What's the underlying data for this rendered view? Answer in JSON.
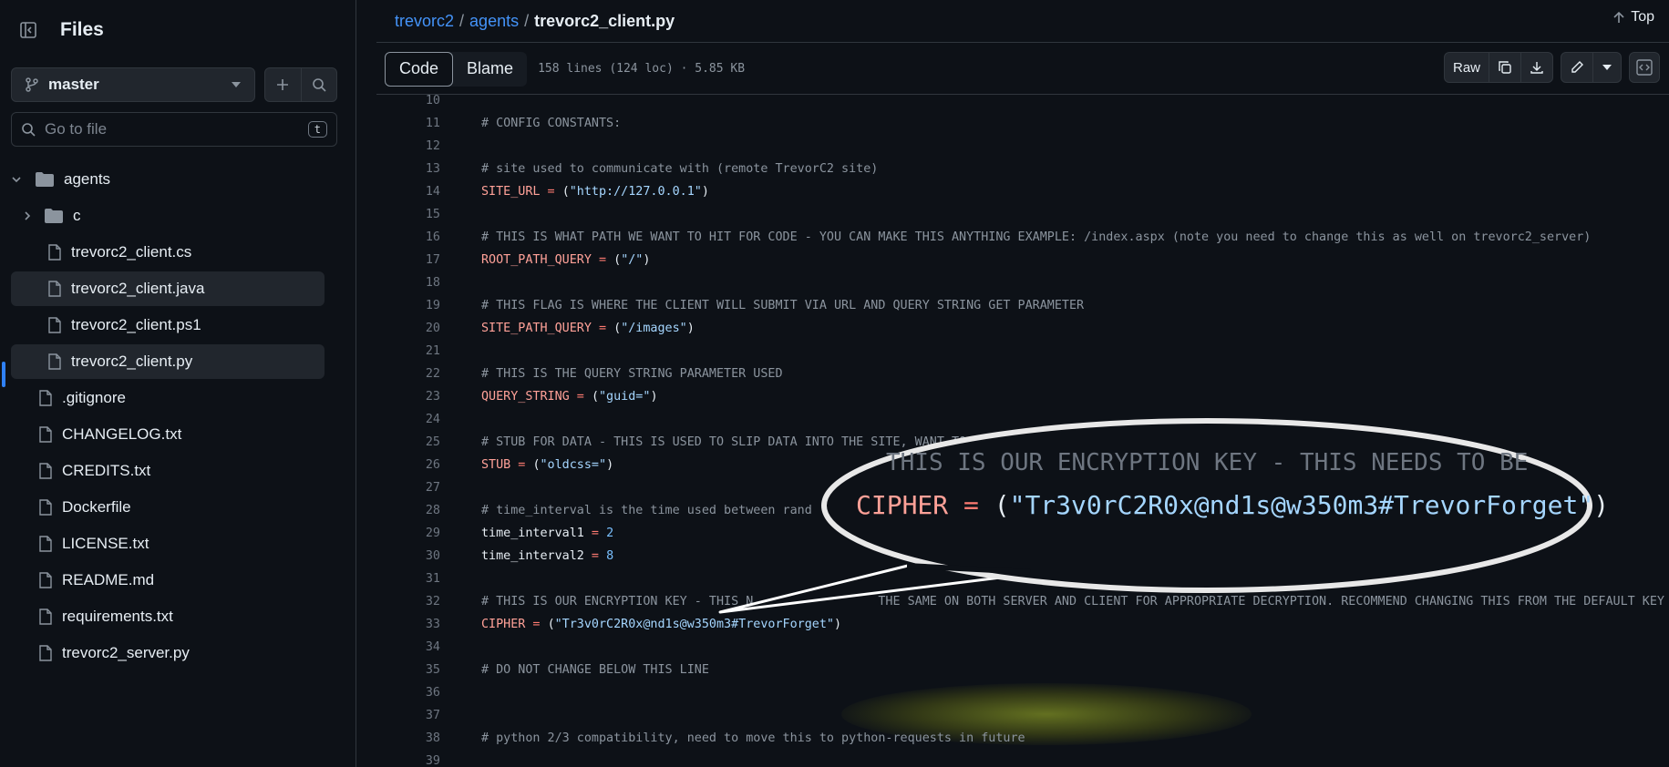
{
  "sidebar": {
    "title": "Files",
    "branch": "master",
    "goto_placeholder": "Go to file",
    "goto_shortcut": "t",
    "tree": [
      {
        "label": "agents",
        "type": "folder-open"
      },
      {
        "label": "c",
        "type": "folder"
      },
      {
        "label": "trevorc2_client.cs",
        "type": "file"
      },
      {
        "label": "trevorc2_client.java",
        "type": "file"
      },
      {
        "label": "trevorc2_client.ps1",
        "type": "file"
      },
      {
        "label": "trevorc2_client.py",
        "type": "file"
      },
      {
        "label": ".gitignore",
        "type": "file"
      },
      {
        "label": "CHANGELOG.txt",
        "type": "file"
      },
      {
        "label": "CREDITS.txt",
        "type": "file"
      },
      {
        "label": "Dockerfile",
        "type": "file"
      },
      {
        "label": "LICENSE.txt",
        "type": "file"
      },
      {
        "label": "README.md",
        "type": "file"
      },
      {
        "label": "requirements.txt",
        "type": "file"
      },
      {
        "label": "trevorc2_server.py",
        "type": "file"
      }
    ]
  },
  "breadcrumb": {
    "repo": "trevorc2",
    "folder": "agents",
    "file": "trevorc2_client.py",
    "sep": "/"
  },
  "top_link": "Top",
  "filebar": {
    "tab_code": "Code",
    "tab_blame": "Blame",
    "meta": "158 lines (124 loc) · 5.85 KB",
    "raw_label": "Raw"
  },
  "code_lines": [
    {
      "n": "10",
      "segs": []
    },
    {
      "n": "11",
      "segs": [
        [
          "cm",
          "# CONFIG CONSTANTS:"
        ]
      ]
    },
    {
      "n": "12",
      "segs": []
    },
    {
      "n": "13",
      "segs": [
        [
          "cm",
          "# site used to communicate with (remote TrevorC2 site)"
        ]
      ]
    },
    {
      "n": "14",
      "segs": [
        [
          "var",
          "SITE_URL"
        ],
        [
          "op",
          " = "
        ],
        [
          "",
          "("
        ],
        [
          "str",
          "\"http://127.0.0.1\""
        ],
        [
          "",
          ")"
        ]
      ]
    },
    {
      "n": "15",
      "segs": []
    },
    {
      "n": "16",
      "segs": [
        [
          "cm",
          "# THIS IS WHAT PATH WE WANT TO HIT FOR CODE - YOU CAN MAKE THIS ANYTHING EXAMPLE: /index.aspx (note you need to change this as well on trevorc2_server)"
        ]
      ]
    },
    {
      "n": "17",
      "segs": [
        [
          "var",
          "ROOT_PATH_QUERY"
        ],
        [
          "op",
          " = "
        ],
        [
          "",
          "("
        ],
        [
          "str",
          "\"/\""
        ],
        [
          "",
          ")"
        ]
      ]
    },
    {
      "n": "18",
      "segs": []
    },
    {
      "n": "19",
      "segs": [
        [
          "cm",
          "# THIS FLAG IS WHERE THE CLIENT WILL SUBMIT VIA URL AND QUERY STRING GET PARAMETER"
        ]
      ]
    },
    {
      "n": "20",
      "segs": [
        [
          "var",
          "SITE_PATH_QUERY"
        ],
        [
          "op",
          " = "
        ],
        [
          "",
          "("
        ],
        [
          "str",
          "\"/images\""
        ],
        [
          "",
          ")"
        ]
      ]
    },
    {
      "n": "21",
      "segs": []
    },
    {
      "n": "22",
      "segs": [
        [
          "cm",
          "# THIS IS THE QUERY STRING PARAMETER USED"
        ]
      ]
    },
    {
      "n": "23",
      "segs": [
        [
          "var",
          "QUERY_STRING"
        ],
        [
          "op",
          " = "
        ],
        [
          "",
          "("
        ],
        [
          "str",
          "\"guid=\""
        ],
        [
          "",
          ")"
        ]
      ]
    },
    {
      "n": "24",
      "segs": []
    },
    {
      "n": "25",
      "segs": [
        [
          "cm",
          "# STUB FOR DATA - THIS IS USED TO SLIP DATA INTO THE SITE, WANT TO"
        ]
      ]
    },
    {
      "n": "26",
      "segs": [
        [
          "var",
          "STUB"
        ],
        [
          "op",
          " = "
        ],
        [
          "",
          "("
        ],
        [
          "str",
          "\"oldcss=\""
        ],
        [
          "",
          ")"
        ]
      ]
    },
    {
      "n": "27",
      "segs": []
    },
    {
      "n": "28",
      "segs": [
        [
          "cm",
          "# time_interval is the time used between rand"
        ]
      ]
    },
    {
      "n": "29",
      "segs": [
        [
          "",
          "time_interval1"
        ],
        [
          "op",
          " = "
        ],
        [
          "num",
          "2"
        ]
      ]
    },
    {
      "n": "30",
      "segs": [
        [
          "",
          "time_interval2"
        ],
        [
          "op",
          " = "
        ],
        [
          "num",
          "8"
        ]
      ]
    },
    {
      "n": "31",
      "segs": []
    },
    {
      "n": "32",
      "segs": [
        [
          "cm",
          "# THIS IS OUR ENCRYPTION KEY - THIS N                 THE SAME ON BOTH SERVER AND CLIENT FOR APPROPRIATE DECRYPTION. RECOMMEND CHANGING THIS FROM THE DEFAULT KEY"
        ]
      ]
    },
    {
      "n": "33",
      "segs": [
        [
          "var",
          "CIPHER"
        ],
        [
          "op",
          " = "
        ],
        [
          "",
          "("
        ],
        [
          "str",
          "\"Tr3v0rC2R0x@nd1s@w350m3#TrevorForget\""
        ],
        [
          "",
          ")"
        ]
      ]
    },
    {
      "n": "34",
      "segs": []
    },
    {
      "n": "35",
      "segs": [
        [
          "cm",
          "# DO NOT CHANGE BELOW THIS LINE"
        ]
      ]
    },
    {
      "n": "36",
      "segs": []
    },
    {
      "n": "37",
      "segs": []
    },
    {
      "n": "38",
      "segs": [
        [
          "cm",
          "# python 2/3 compatibility, need to move this to python-requests in future"
        ]
      ]
    },
    {
      "n": "39",
      "segs": []
    }
  ],
  "callout": {
    "comment": "THIS IS OUR ENCRYPTION KEY - THIS NEEDS TO BE",
    "var": "CIPHER",
    "op": " = ",
    "open": "(",
    "str": "\"Tr3v0rC2R0x@nd1s@w350m3#TrevorForget\"",
    "close": ")"
  },
  "colors": {
    "bg": "#0d1117",
    "accent": "#2f81f7",
    "link": "#4493f8",
    "comment": "#8b949e",
    "variable": "#ffa198",
    "string": "#a5d6ff"
  }
}
